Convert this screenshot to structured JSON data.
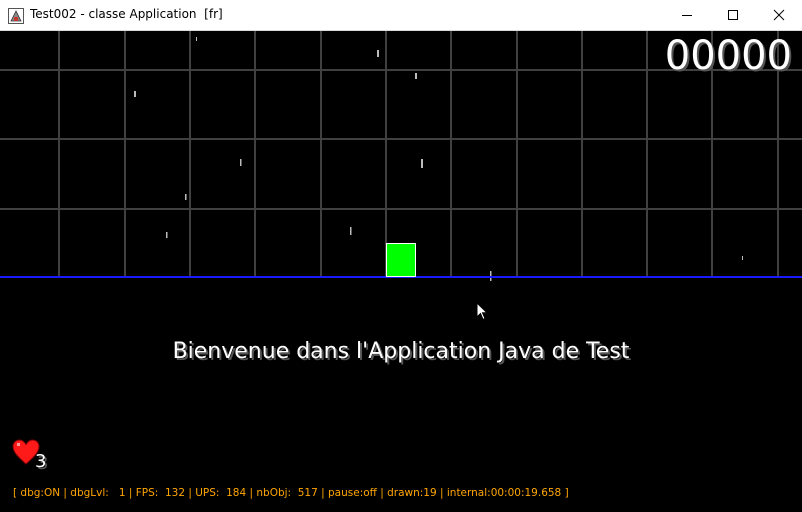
{
  "window": {
    "title": "Test002 - classe Application  [fr]",
    "icons": {
      "app": "java-app-icon",
      "minimize": "minimize-icon",
      "maximize": "maximize-icon",
      "close": "close-icon"
    }
  },
  "game": {
    "score": "00000",
    "welcome": "Bienvenue dans l'Application Java de Test",
    "lives": "3",
    "debug": "[ dbg:ON | dbgLvl:   1 | FPS:  132 | UPS:  184 | nbObj:  517 | pause:off | drawn:19 | internal:00:00:19.658 ]",
    "colors": {
      "background": "#000000",
      "grid": "#404040",
      "ground": "#1a1aff",
      "player": "#00ff00",
      "debug_text": "#ffa500",
      "heart": "#ff1a1a"
    }
  }
}
